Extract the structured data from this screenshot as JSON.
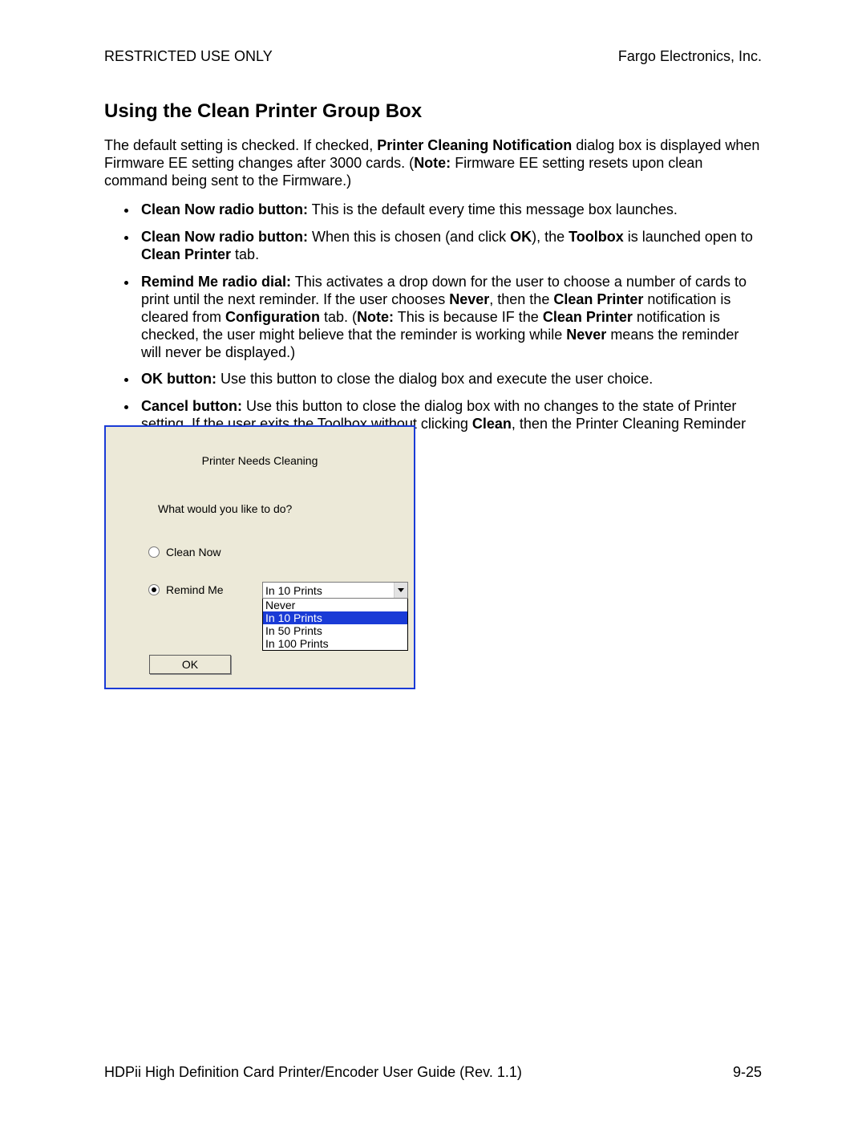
{
  "header": {
    "left": "RESTRICTED USE ONLY",
    "right": "Fargo Electronics, Inc."
  },
  "section_title": "Using the Clean Printer Group Box",
  "intro": {
    "pre": "The default setting is checked. If checked, ",
    "b1": "Printer Cleaning Notification",
    "mid": " dialog box is displayed when Firmware EE setting changes after 3000 cards. (",
    "b2": "Note:",
    "post": "  Firmware EE setting resets upon clean command being sent to the Firmware.)"
  },
  "bullets": {
    "i1": {
      "b": "Clean Now radio button:",
      "t": "  This is the default every time this message box launches."
    },
    "i2": {
      "b": "Clean Now radio button:",
      "t1": "   When this is chosen (and click ",
      "b2": "OK",
      "t2": "), the ",
      "b3": "Toolbox",
      "t3": " is launched open to ",
      "b4": "Clean Printer",
      "t4": " tab."
    },
    "i3": {
      "b": "Remind Me radio dial:",
      "t1": "  This activates a drop down for the user to choose a number of cards to print until the next reminder. If the user chooses ",
      "b2": "Never",
      "t2": ", then the ",
      "b3": "Clean Printer",
      "t3": " notification is cleared from ",
      "b4": "Configuration",
      "t4": " tab. (",
      "b5": "Note:",
      "t5": "  This is because IF the ",
      "b6": "Clean Printer",
      "t6": " notification is checked, the user might believe that the reminder is working while ",
      "b7": "Never",
      "t7": " means the reminder will never be displayed.)"
    },
    "i4": {
      "b": "OK button:",
      "t": "  Use this button to close the dialog box and execute the user choice."
    },
    "i5": {
      "b": "Cancel button:",
      "t1": "  Use this button to close the dialog box with no changes to the state of Printer setting. If the user exits the Toolbox without clicking ",
      "b2": "Clean",
      "t2": ", then the Printer Cleaning Reminder dialog box will reappear on the next print."
    }
  },
  "dialog": {
    "title": "Printer Needs Cleaning",
    "prompt": "What would you like to do?",
    "radio1": "Clean Now",
    "radio2": "Remind Me",
    "selected": "In 10 Prints",
    "options": {
      "o1": "Never",
      "o2": "In 10 Prints",
      "o3": "In 50 Prints",
      "o4": "In 100 Prints"
    },
    "ok": "OK"
  },
  "footer": {
    "left": "HDPii High Definition Card Printer/Encoder User Guide (Rev. 1.1)",
    "right": "9-25"
  }
}
